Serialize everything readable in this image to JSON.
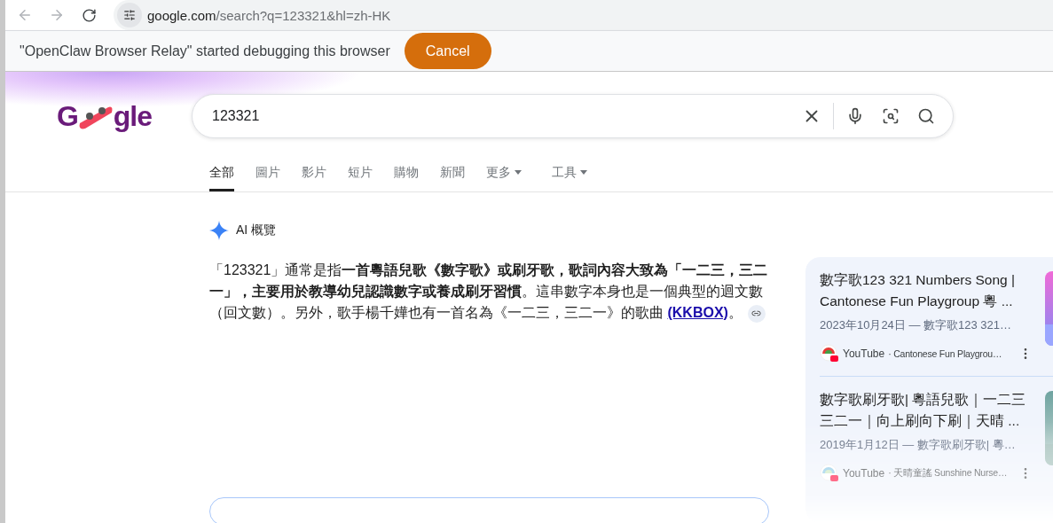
{
  "browser": {
    "url_host": "google.com",
    "url_path": "/search?q=123321&hl=zh-HK"
  },
  "infobar": {
    "message": "\"OpenClaw Browser Relay\" started debugging this browser",
    "button": "Cancel"
  },
  "logo": {
    "start": "G",
    "end": "gle"
  },
  "search": {
    "value": "123321"
  },
  "tabs": [
    {
      "label": "全部",
      "selected": true,
      "kind": "tab"
    },
    {
      "label": "圖片",
      "selected": false,
      "kind": "tab"
    },
    {
      "label": "影片",
      "selected": false,
      "kind": "tab"
    },
    {
      "label": "短片",
      "selected": false,
      "kind": "tab"
    },
    {
      "label": "購物",
      "selected": false,
      "kind": "tab"
    },
    {
      "label": "新聞",
      "selected": false,
      "kind": "tab"
    },
    {
      "label": "更多",
      "selected": false,
      "kind": "menu"
    },
    {
      "label": "工具",
      "selected": false,
      "kind": "menu"
    }
  ],
  "ai_overview": {
    "title": "AI 概覽",
    "text": "「123321」通常是指**一首粵語兒歌《數字歌》或刷牙歌，歌詞內容大致為「一二三，三二一」，主要用於教導幼兒認識數字或養成刷牙習慣**。這串數字本身也是一個典型的迴文數（回文數）。另外，歌手楊千嬅也有一首名為《一二三，三二一》的歌曲 ",
    "link": "(KKBOX)",
    "after": "。"
  },
  "results": [
    {
      "title": "數字歌123 321 Numbers Song | Cantonese Fun Playgroup 粵 ...",
      "date": "2023年10月24日 — 數字歌123 321…",
      "site": "YouTube",
      "channel": "· Cantonese Fun Playgrou…"
    },
    {
      "title": "數字歌刷牙歌| 粵語兒歌｜一二三三二一｜向上刷向下刷｜天晴 ...",
      "date": "2019年1月12日 — 數字歌刷牙歌| 粵…",
      "site": "YouTube",
      "channel": "· 天晴童謠 Sunshine Nurse…"
    }
  ]
}
